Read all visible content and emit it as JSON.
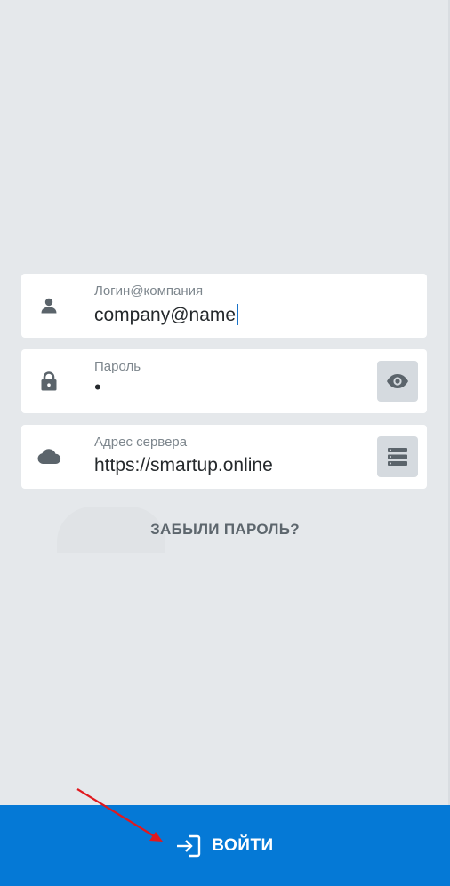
{
  "form": {
    "login": {
      "label": "Логин@компания",
      "value": "company@name",
      "icon": "person-icon"
    },
    "password": {
      "label": "Пароль",
      "value": "•",
      "icon": "lock-icon",
      "action_icon": "eye-icon"
    },
    "server": {
      "label": "Адрес сервера",
      "value": "https://smartup.online",
      "icon": "cloud-icon",
      "action_icon": "server-list-icon"
    }
  },
  "forgot_password_label": "ЗАБЫЛИ ПАРОЛЬ?",
  "login_button": {
    "label": "ВОЙТИ",
    "icon": "sign-in-icon"
  },
  "colors": {
    "accent": "#0579d6",
    "background": "#e5e8eb",
    "annotation_arrow": "#e0191e"
  }
}
